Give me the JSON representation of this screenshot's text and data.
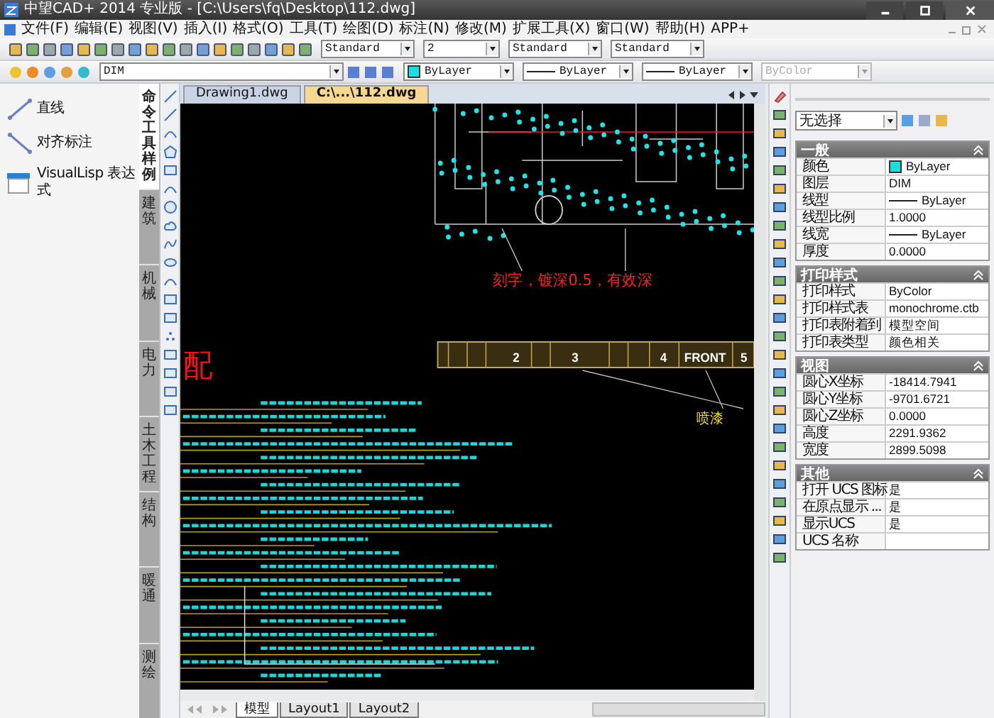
{
  "window": {
    "title": "中望CAD+ 2014 专业版 - [C:\\Users\\fq\\Desktop\\112.dwg]"
  },
  "menu": [
    "文件(F)",
    "编辑(E)",
    "视图(V)",
    "插入(I)",
    "格式(O)",
    "工具(T)",
    "绘图(D)",
    "标注(N)",
    "修改(M)",
    "扩展工具(X)",
    "窗口(W)",
    "帮助(H)",
    "APP+"
  ],
  "style_dropdowns": [
    {
      "value": "Standard"
    },
    {
      "value": "2"
    },
    {
      "value": "Standard"
    },
    {
      "value": "Standard"
    }
  ],
  "properties_toolbar": {
    "layer": "DIM",
    "color_setting": "ByLayer",
    "linetype": "ByLayer",
    "lineweight": "ByLayer",
    "plot_style": "ByColor",
    "plot_style_disabled": true
  },
  "tool_palette": {
    "items": [
      {
        "label": "直线",
        "kind": "line"
      },
      {
        "label": "对齐标注",
        "kind": "dimension"
      },
      {
        "label": "VisualLisp 表达式",
        "kind": "lisp"
      }
    ],
    "tabs": [
      {
        "label": "命令工具样例",
        "selected": true
      },
      {
        "label": "建筑",
        "selected": false
      },
      {
        "label": "机械",
        "selected": false
      },
      {
        "label": "电力",
        "selected": false
      },
      {
        "label": "土木工程",
        "selected": false
      },
      {
        "label": "结构",
        "selected": false
      },
      {
        "label": "暖通",
        "selected": false
      },
      {
        "label": "测绘",
        "selected": false
      }
    ]
  },
  "document_tabs": [
    {
      "label": "Drawing1.dwg",
      "selected": false
    },
    {
      "label": "C:\\...\\112.dwg",
      "selected": true
    }
  ],
  "drawing": {
    "engraving_note": "刻字，镀深0.5，有效深",
    "large_char": "配",
    "strip_labels": [
      "2",
      "3",
      "4",
      "FRONT",
      "5"
    ],
    "paint_note": "喷漆"
  },
  "layout_tabs": [
    {
      "label": "模型",
      "selected": true
    },
    {
      "label": "Layout1",
      "selected": false
    },
    {
      "label": "Layout2",
      "selected": false
    }
  ],
  "properties": {
    "selection": "无选择",
    "sections": [
      {
        "title": "一般",
        "rows": [
          {
            "label": "颜色",
            "value": "ByLayer",
            "kind": "color"
          },
          {
            "label": "图层",
            "value": "DIM",
            "kind": "text"
          },
          {
            "label": "线型",
            "value": "ByLayer",
            "kind": "line"
          },
          {
            "label": "线型比例",
            "value": "1.0000",
            "kind": "text"
          },
          {
            "label": "线宽",
            "value": "ByLayer",
            "kind": "line"
          },
          {
            "label": "厚度",
            "value": "0.0000",
            "kind": "text"
          }
        ]
      },
      {
        "title": "打印样式",
        "rows": [
          {
            "label": "打印样式",
            "value": "ByColor",
            "kind": "text"
          },
          {
            "label": "打印样式表",
            "value": "monochrome.ctb",
            "kind": "text"
          },
          {
            "label": "打印表附着到",
            "value": "模型空间",
            "kind": "text"
          },
          {
            "label": "打印表类型",
            "value": "颜色相关",
            "kind": "text"
          }
        ]
      },
      {
        "title": "视图",
        "rows": [
          {
            "label": "圆心X坐标",
            "value": "-18414.7941",
            "kind": "text"
          },
          {
            "label": "圆心Y坐标",
            "value": "-9701.6721",
            "kind": "text"
          },
          {
            "label": "圆心Z坐标",
            "value": "0.0000",
            "kind": "text"
          },
          {
            "label": "高度",
            "value": "2291.9362",
            "kind": "text"
          },
          {
            "label": "宽度",
            "value": "2899.5098",
            "kind": "text"
          }
        ]
      },
      {
        "title": "其他",
        "rows": [
          {
            "label": "打开 UCS 图标",
            "value": "是",
            "kind": "text"
          },
          {
            "label": "在原点显示 ...",
            "value": "是",
            "kind": "text"
          },
          {
            "label": "显示UCS",
            "value": "是",
            "kind": "text"
          },
          {
            "label": "UCS 名称",
            "kind": "text"
          }
        ]
      }
    ]
  }
}
